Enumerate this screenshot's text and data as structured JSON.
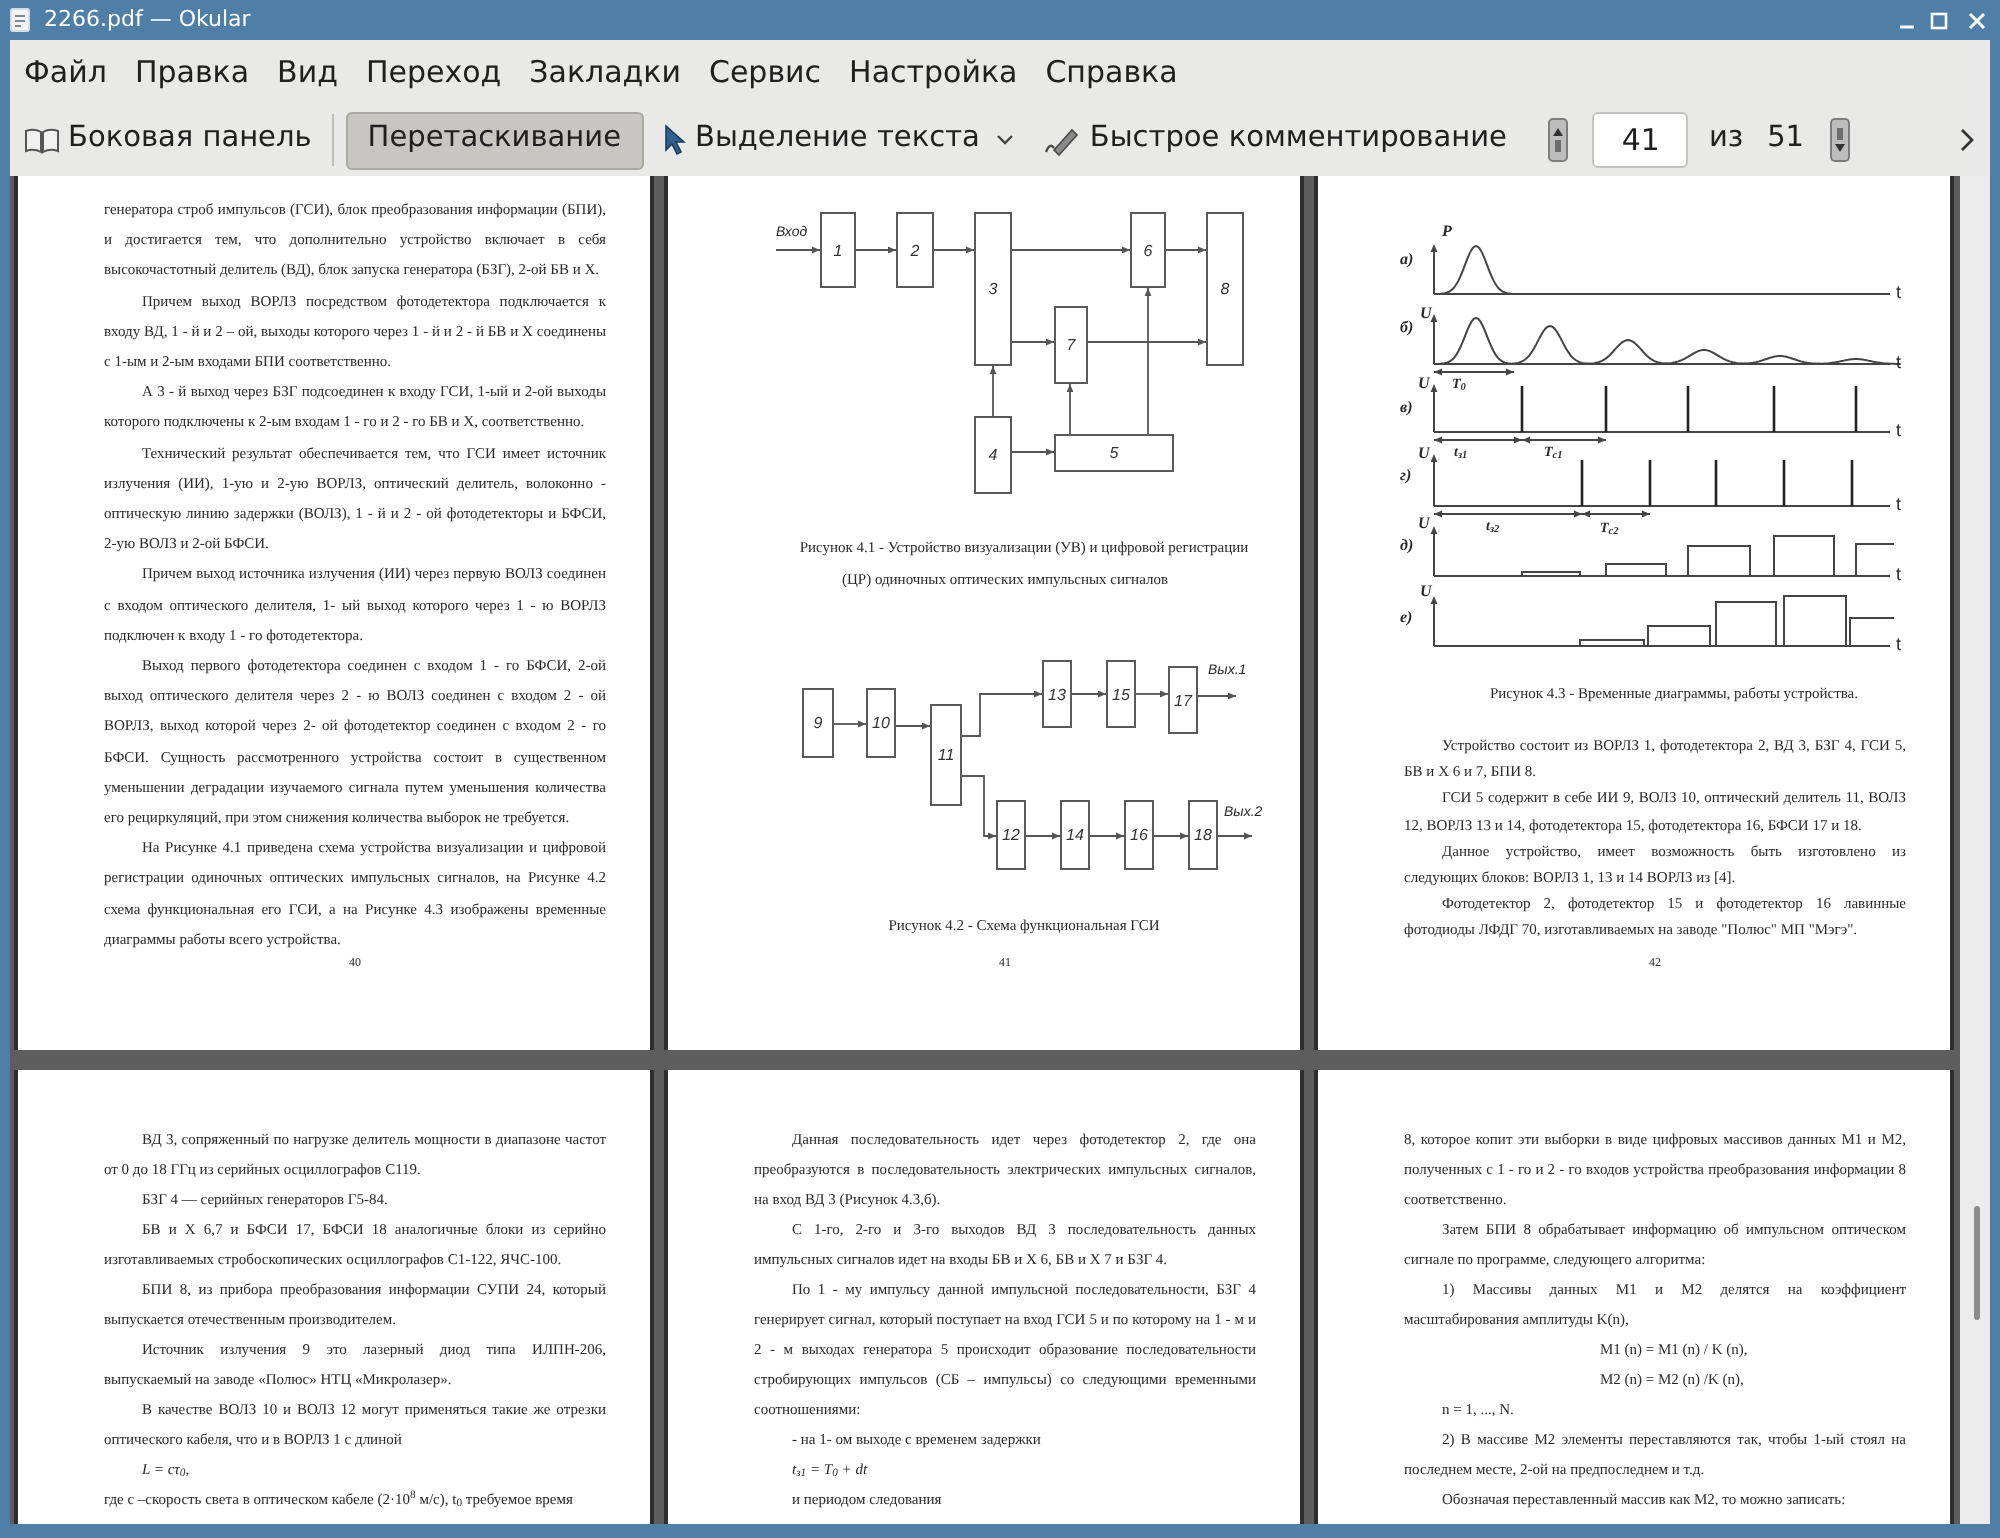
{
  "window": {
    "title": "2266.pdf — Okular"
  },
  "menu_bar": [
    {
      "label": "Файл"
    },
    {
      "label": "Правка"
    },
    {
      "label": "Вид"
    },
    {
      "label": "Переход"
    },
    {
      "label": "Закладки"
    },
    {
      "label": "Сервис"
    },
    {
      "label": "Настройка"
    },
    {
      "label": "Справка"
    }
  ],
  "toolbar": {
    "sidebar_toggle": {
      "label": "Боковая панель"
    },
    "tools": [
      {
        "kind": "browse",
        "label": "Перетаскивание",
        "selected": true,
        "dropdown": false
      },
      {
        "kind": "select",
        "label": "Выделение текста",
        "selected": false,
        "dropdown": true
      },
      {
        "kind": "annotate",
        "label": "Быстрое комментирование",
        "selected": false,
        "dropdown": false
      }
    ],
    "page_field": {
      "value": "41"
    },
    "of_label": "из",
    "page_count": "51"
  },
  "pages": [
    {
      "page_number": "40",
      "content": [
        {
          "kind": "paragraph",
          "indent": false,
          "text": "генератора строб импульсов (ГСИ), блок преобразования информации (БПИ), и достигается тем, что дополнительно устройство включает в себя высокочастотный делитель (ВД), блок запуска генератора (БЗГ), 2-ой БВ и Х."
        },
        {
          "kind": "paragraph",
          "indent": true,
          "text": "Причем выход ВОРЛЗ посредством фотодетектора подключается к входу ВД, 1 - й и 2 – ой, выходы которого через 1 - й и 2 - й БВ и Х соединены с 1-ым и 2-ым входами БПИ соответственно."
        },
        {
          "kind": "paragraph",
          "indent": true,
          "text": "А 3 - й выход через БЗГ подсоединен к входу ГСИ, 1-ый и 2-ой выходы которого подключены к 2-ым входам 1 - го и 2 - го БВ и Х, соответственно."
        },
        {
          "kind": "paragraph",
          "indent": true,
          "text": "Технический результат обеспечивается тем, что ГСИ имеет источник излучения (ИИ), 1-ую и 2-ую ВОРЛЗ, оптический делитель, волоконно - оптическую линию задержки (ВОЛЗ), 1 - й и 2 - ой фотодетекторы и БФСИ, 2-ую ВОЛЗ и 2-ой БФСИ."
        },
        {
          "kind": "paragraph",
          "indent": true,
          "text": "Причем выход источника излучения (ИИ) через первую ВОЛЗ соединен с входом оптического делителя, 1- ый выход которого через 1 - ю ВОРЛЗ подключен к входу 1 - го фотодетектора."
        },
        {
          "kind": "paragraph",
          "indent": true,
          "text": "Выход первого фотодетектора соединен с входом 1 - го БФСИ, 2-ой выход оптического делителя через 2 - ю ВОЛЗ соединен с входом 2 - ой ВОРЛЗ, выход которой через 2- ой фотодетектор соединен с входом 2 - го БФСИ. Сущность рассмотренного устройства состоит в существенном уменьшении деградации изучаемого сигнала путем уменьшения количества его рециркуляций, при этом снижения количества выборок не требуется."
        },
        {
          "kind": "paragraph",
          "indent": true,
          "text": "На Рисунке 4.1 приведена схема устройства визуализации и цифровой регистрации одиночных оптических импульсных сигналов, на Рисунке 4.2 схема функциональная его ГСИ, а на Рисунке 4.3 изображены временные диаграммы работы всего устройства."
        }
      ]
    },
    {
      "page_number": "41",
      "content": [
        {
          "kind": "device_scheme",
          "input_label": "Вход",
          "units": [
            "1",
            "2",
            "3",
            "4",
            "5",
            "6",
            "7",
            "8"
          ]
        },
        {
          "kind": "caption",
          "text": "Рисунок 4.1 - Устройство визуализации (УВ) и цифровой регистрации (ЦР) одиночных оптических импульсных сигналов"
        },
        {
          "kind": "generator_scheme",
          "units": [
            "9",
            "10",
            "11",
            "12",
            "13",
            "14",
            "15",
            "16",
            "17",
            "18"
          ],
          "outputs": [
            "Вых.1",
            "Вых.2"
          ]
        },
        {
          "kind": "caption",
          "text": "Рисунок 4.2 - Схема функциональная ГСИ"
        }
      ]
    },
    {
      "page_number": "42",
      "content": [
        {
          "kind": "timing_diagram",
          "rows": [
            {
              "kind": "single_pulse",
              "label": "а)",
              "axis_label": "P",
              "time_label": "t"
            },
            {
              "kind": "decaying_pulses",
              "label": "б)",
              "axis_label": "U",
              "time_label": "t",
              "intervals": [
                "T$_{0}$"
              ]
            },
            {
              "kind": "strobes",
              "label": "в)",
              "axis_label": "U",
              "time_label": "t",
              "intervals": [
                "t$_{з1}$",
                "T$_{c1}$"
              ]
            },
            {
              "kind": "strobes",
              "label": "г)",
              "axis_label": "U",
              "time_label": "t",
              "intervals": [
                "t$_{з2}$",
                "T$_{c2}$"
              ]
            },
            {
              "kind": "samples",
              "label": "д)",
              "axis_label": "U",
              "time_label": "t"
            },
            {
              "kind": "samples",
              "label": "е)",
              "axis_label": "U",
              "time_label": "t"
            }
          ]
        },
        {
          "kind": "caption",
          "text": "Рисунок 4.3 - Временные диаграммы, работы устройства."
        },
        {
          "kind": "paragraph",
          "indent": true,
          "text": "Устройство состоит из ВОРЛЗ 1, фотодетектора 2, ВД 3, БЗГ 4, ГСИ 5, БВ и Х 6 и 7, БПИ 8."
        },
        {
          "kind": "paragraph",
          "indent": true,
          "text": "ГСИ 5 содержит в себе ИИ 9, ВОЛЗ 10, оптический делитель 11, ВОЛЗ 12, ВОРЛЗ 13 и 14, фотодетектора 15, фотодетектора 16, БФСИ 17 и 18."
        },
        {
          "kind": "paragraph",
          "indent": true,
          "text": "Данное устройство, имеет возможность быть изготовлено из следующих блоков: ВОРЛЗ 1, 13 и 14 ВОРЛЗ из [4]."
        },
        {
          "kind": "paragraph",
          "indent": true,
          "text": "Фотодетектор 2, фотодетектор 15 и фотодетектор 16 лавинные фотодиоды ЛФДГ 70, изготавливаемых на заводе \"Полюс\" МП \"Мэгэ\"."
        }
      ]
    },
    {
      "content": [
        {
          "kind": "paragraph",
          "indent": true,
          "text": "ВД 3, сопряженный по нагрузке делитель мощности в диапазоне частот от 0 до 18 ГГц из серийных осциллографов С119."
        },
        {
          "kind": "paragraph",
          "indent": true,
          "text": "БЗГ 4 –– серийных генераторов Г5-84."
        },
        {
          "kind": "paragraph",
          "indent": true,
          "text": "БВ и Х 6,7 и БФСИ 17, БФСИ 18 аналогичные блоки из серийно изготавливаемых стробоскопических осциллографов С1-122, ЯЧС-100."
        },
        {
          "kind": "paragraph",
          "indent": true,
          "text": "БПИ 8, из прибора преобразования информации СУПИ 24, который выпускается отечественным производителем."
        },
        {
          "kind": "paragraph",
          "indent": true,
          "text": "Источник излучения 9 это лазерный диод типа ИЛПН-206, выпускаемый на заводе «Полюс» НТЦ «Микролазер»."
        },
        {
          "kind": "paragraph",
          "indent": true,
          "text": "В качестве ВОЛЗ 10 и ВОЛЗ 12 могут применяться такие же отрезки оптического кабеля, что и в ВОРЛЗ 1 с длиной"
        },
        {
          "kind": "formula",
          "indent": true,
          "text": "L = cτ$_{0}$,"
        },
        {
          "kind": "paragraph",
          "indent": false,
          "text": "где с –скорость света в оптическом кабеле (2·10$^{8}$ м/с), t$_{0}$ требуемое время"
        }
      ]
    },
    {
      "content": [
        {
          "kind": "paragraph",
          "indent": true,
          "text": "Данная последовательность идет через фотодетектор 2, где она преобразуются в последовательность электрических импульсных сигналов, на вход ВД 3 (Рисунок 4.3,б)."
        },
        {
          "kind": "paragraph",
          "indent": true,
          "text": "С 1-го, 2-го и 3-го выходов ВД 3 последовательность данных импульсных сигналов идет на входы БВ и Х 6, БВ и Х 7 и БЗГ 4."
        },
        {
          "kind": "paragraph",
          "indent": true,
          "text": "По 1 - му импульсу данной импульсной последовательности, БЗГ 4 генерирует сигнал, который поступает на вход ГСИ 5 и по которому на 1 - м и 2 - м выходах генератора 5 происходит образование последовательности стробирующих импульсов (СБ – импульсы) со следующими временными соотношениями:"
        },
        {
          "kind": "paragraph",
          "indent": true,
          "text": "- на 1- ом выходе с временем задержки"
        },
        {
          "kind": "formula",
          "indent": true,
          "text": "t$_{з1}$ = T$_{0}$ + dt"
        },
        {
          "kind": "paragraph",
          "indent": true,
          "text": "и периодом следования"
        }
      ]
    },
    {
      "content": [
        {
          "kind": "paragraph",
          "indent": false,
          "text": "8, которое копит эти выборки в виде цифровых массивов данных М1 и М2, полученных с 1 - го и 2 - го входов устройства преобразования информации 8 соответственно."
        },
        {
          "kind": "paragraph",
          "indent": true,
          "text": "Затем БПИ 8 обрабатывает информацию об импульсном оптическом сигнале по программе, следующего алгоритма:"
        },
        {
          "kind": "paragraph",
          "indent": true,
          "text": "1) Массивы данных М1 и М2 делятся на коэффициент масштабирования амплитуды K(n),"
        },
        {
          "kind": "equation",
          "text": "M1 (n) = M1 (n) / K (n),"
        },
        {
          "kind": "equation",
          "text": "M2 (n) = M2 (n) /K (n),"
        },
        {
          "kind": "paragraph",
          "indent": true,
          "text": "n = 1, ..., N."
        },
        {
          "kind": "paragraph",
          "indent": true,
          "text": "2) В массиве М2 элементы переставляются так, чтобы 1-ый стоял на последнем месте, 2-ой на предпоследнем и т.д."
        },
        {
          "kind": "paragraph",
          "indent": true,
          "text": "Обозначая переставленный массив как М2, то можно записать:"
        }
      ]
    }
  ]
}
